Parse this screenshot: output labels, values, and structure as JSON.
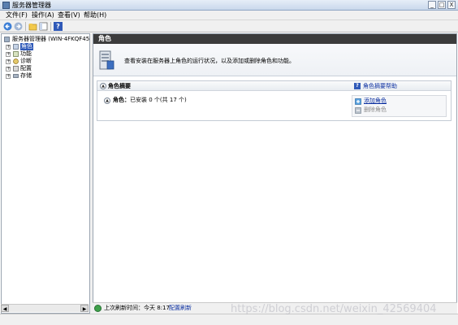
{
  "window": {
    "title": "服务器管理器",
    "buttons": {
      "minimize": "_",
      "maximize": "□",
      "close": "X"
    }
  },
  "menu": [
    {
      "label": "文件(F)"
    },
    {
      "label": "操作(A)"
    },
    {
      "label": "查看(V)"
    },
    {
      "label": "帮助(H)"
    }
  ],
  "toolbar": {
    "icons": [
      "back-arrow-icon",
      "forward-arrow-icon",
      "up-folder-icon",
      "show-hide-tree-icon",
      "help-icon"
    ]
  },
  "tree": {
    "root": "服务器管理器 (WIN-4FKQF45MPS",
    "items": [
      {
        "label": "角色",
        "selected": true
      },
      {
        "label": "功能"
      },
      {
        "label": "诊断"
      },
      {
        "label": "配置"
      },
      {
        "label": "存储"
      }
    ]
  },
  "main": {
    "header": "角色",
    "intro": "查看安装在服务器上角色的运行状况，以及添加或删除角色和功能。",
    "summary": {
      "title": "角色摘要",
      "help_link": "角色摘要帮助",
      "roles_label": "角色：",
      "roles_status": "已安装 0 个(共 17 个)",
      "actions": [
        {
          "label": "添加角色",
          "enabled": true
        },
        {
          "label": "删除角色",
          "enabled": false
        }
      ]
    }
  },
  "status": {
    "refresh_label": "上次刷新时间：今天 8:17",
    "configure_link": "配置刷新"
  },
  "watermark": "https://blog.csdn.net/weixin_42569404",
  "colors": {
    "header_bg": "#3c3c3c",
    "link": "#0b2fa0",
    "selection": "#2f59b8"
  }
}
